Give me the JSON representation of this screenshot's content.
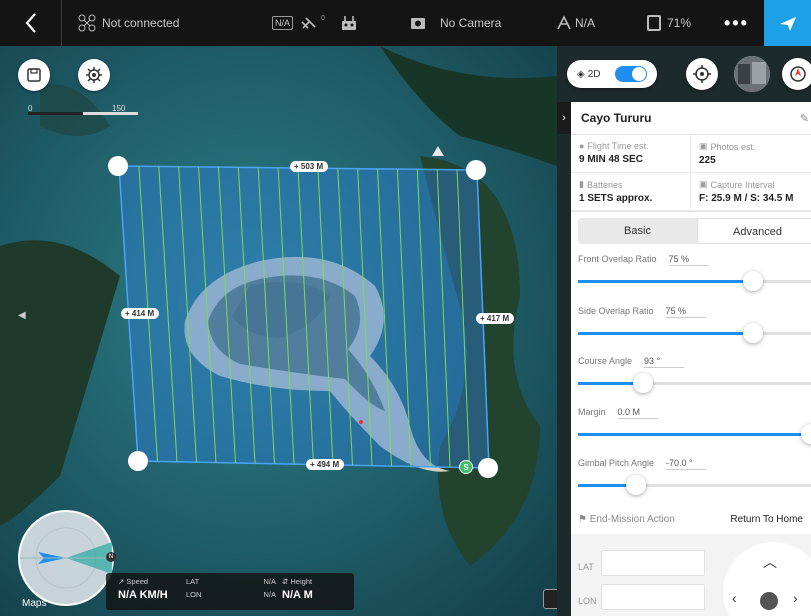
{
  "topbar": {
    "connection": "Not connected",
    "na_box": "N/A",
    "satellite_count": "0",
    "camera": "No Camera",
    "signal": "N/A",
    "battery": "71%",
    "more": "•••"
  },
  "map": {
    "scale_min": "0",
    "scale_max": "150",
    "width_top": "503 M",
    "width_bottom": "494 M",
    "height_left": "414 M",
    "height_right": "417 M",
    "start_marker": "S",
    "maps_logo": "Maps"
  },
  "telemetry": {
    "speed_label": "Speed",
    "speed_value": "N/A KM/H",
    "lat_label": "LAT",
    "lat_value": "N/A",
    "lon_label": "LON",
    "lon_value": "N/A",
    "height_label": "Height",
    "height_value": "N/A M",
    "compass_n": "N"
  },
  "mode_toggle": {
    "label": "2D",
    "on": true
  },
  "panel": {
    "title": "Cayo Tururu",
    "stats": [
      {
        "label": "Flight Time est.",
        "value": "9 MIN 48 SEC",
        "icon": "clock-icon"
      },
      {
        "label": "Photos est.",
        "value": "225",
        "icon": "photo-icon"
      },
      {
        "label": "Batteries",
        "value": "1 SETS approx.",
        "icon": "battery-icon"
      },
      {
        "label": "Capture Interval",
        "value": "F: 25.9 M / S: 34.5 M",
        "icon": "camera-icon"
      }
    ],
    "tabs": [
      "Basic",
      "Advanced"
    ],
    "active_tab": "Advanced",
    "sliders": [
      {
        "label": "Front Overlap Ratio",
        "value": "75 %",
        "fraction": 0.75
      },
      {
        "label": "Side Overlap Ratio",
        "value": "75 %",
        "fraction": 0.75
      },
      {
        "label": "Course Angle",
        "value": "93 °",
        "fraction": 0.28
      },
      {
        "label": "Margin",
        "value": "0.0 M",
        "fraction": 1.0
      },
      {
        "label": "Gimbal Pitch Angle",
        "value": "-70.0 °",
        "fraction": 0.25
      }
    ],
    "end_action_label": "End-Mission Action",
    "end_action_value": "Return To Home",
    "lat_label": "LAT",
    "lon_label": "LON"
  },
  "colors": {
    "accent": "#1e8ef0",
    "flight_lines": "#7ed957",
    "area_fill": "#2f7fd8",
    "plane_button": "#1ea0e9"
  }
}
